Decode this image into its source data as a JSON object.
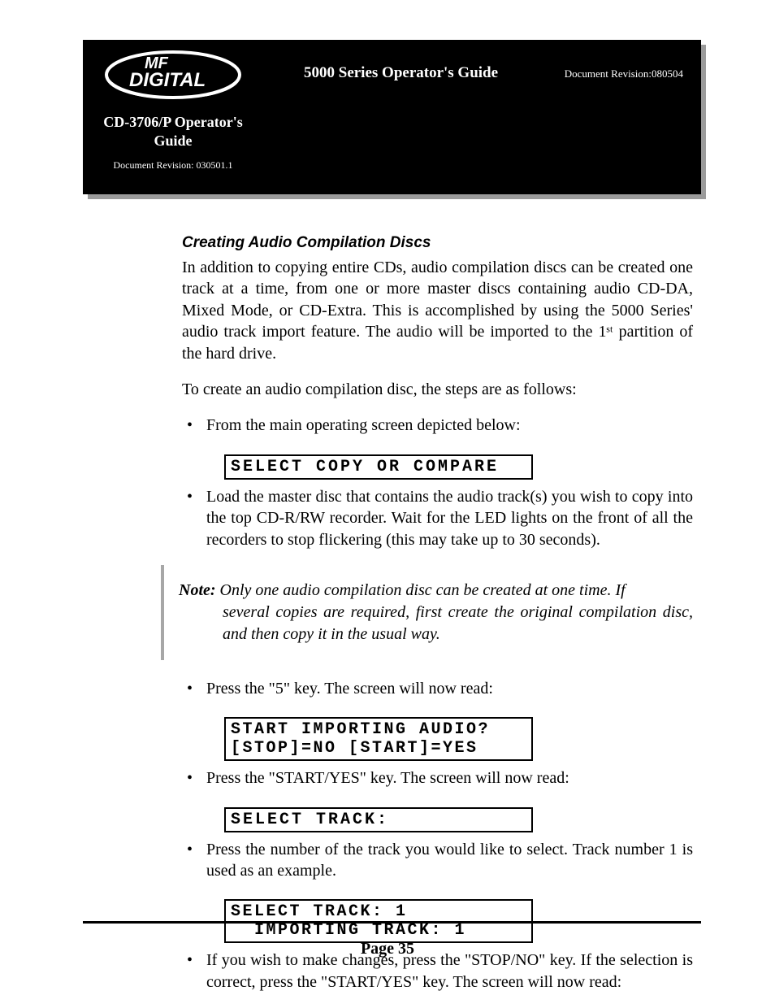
{
  "header": {
    "logo_line1": "MF",
    "logo_line2": "DIGITAL",
    "left_title_l1": "CD-3706/P Operator's",
    "left_title_l2": "Guide",
    "left_revision": "Document Revision: 030501.1",
    "center_title": "5000 Series Operator's Guide",
    "doc_revision": "Document Revision:080504"
  },
  "body": {
    "section_heading": "Creating Audio Compilation Discs",
    "intro": "In addition to copying entire CDs, audio compilation discs can be created one track at a time, from one or more master discs containing audio CD-DA, Mixed Mode, or CD-Extra. This is accomplished by using the 5000 Series' audio track import feature. The audio will be imported to the 1ˢᵗ partition of the hard drive.",
    "lead_in": "To create an audio compilation disc, the steps are as follows:",
    "bullets_a": [
      "From the main operating screen depicted below:"
    ],
    "lcd1": "SELECT COPY OR COMPARE",
    "bullets_b": [
      "Load the master disc that contains the audio track(s) you wish to copy into the top CD-R/RW recorder. Wait for the LED lights on the front of all the recorders to stop flickering (this may take up to 30 seconds)."
    ],
    "note_label": "Note:",
    "note_text_line1": "Only one audio compilation disc can be created at one time. If",
    "note_text_line2": "several copies are required, first create the original compilation disc, and then copy it in the usual way.",
    "bullets_c": [
      "Press the \"5\" key. The screen will now read:"
    ],
    "lcd2_l1": "START IMPORTING AUDIO?",
    "lcd2_l2": "[STOP]=NO [START]=YES",
    "bullets_d": [
      "Press the \"START/YES\" key. The screen will now read:"
    ],
    "lcd3": "SELECT TRACK:",
    "bullets_e": [
      "Press the number of the track you would like to select. Track number 1 is used as an example."
    ],
    "lcd4_l1": "SELECT TRACK: 1",
    "lcd4_l2": "  IMPORTING TRACK: 1",
    "bullets_f": [
      "If you wish to make changes, press the \"STOP/NO\" key. If the selection is correct, press the \"START/YES\" key. The screen will now read:"
    ]
  },
  "page_number": "Page 35"
}
